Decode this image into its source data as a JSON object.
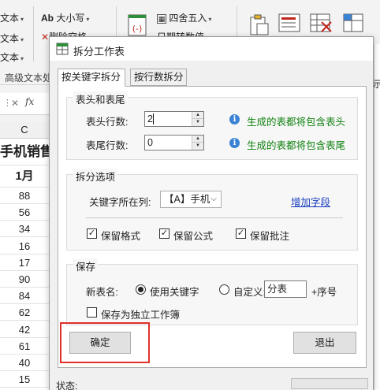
{
  "ribbon": {
    "left_items": [
      "文本",
      "文本",
      "文本"
    ],
    "case_label": "大小写",
    "case_icon_text": "Ab",
    "delete_label": "删除空格",
    "round_label": "四舍五入",
    "dateconv_label": "日期转数值",
    "advanced_text_label": "高级文本处"
  },
  "formula_bar": {
    "fx_label": "fx"
  },
  "sheet": {
    "column_header": "C",
    "title_cell": "手机销售",
    "month_cell": "1月",
    "values": [
      "88",
      "56",
      "34",
      "16",
      "17",
      "90",
      "84",
      "62",
      "42",
      "61",
      "40",
      "15",
      "79"
    ]
  },
  "dialog": {
    "title": "拆分工作表",
    "tabs": [
      {
        "label": "按关键字拆分",
        "active": true
      },
      {
        "label": "按行数拆分",
        "active": false
      }
    ],
    "header_footer": {
      "title": "表头和表尾",
      "header_rows_label": "表头行数:",
      "header_rows_value": "2",
      "header_hint": "生成的表都将包含表头",
      "footer_rows_label": "表尾行数:",
      "footer_rows_value": "0",
      "footer_hint": "生成的表都将包含表尾"
    },
    "split_options": {
      "title": "拆分选项",
      "key_column_label": "关键字所在列:",
      "key_column_value": "【A】手机",
      "add_field_link": "增加字段",
      "checkboxes": [
        {
          "label": "保留格式",
          "checked": true
        },
        {
          "label": "保留公式",
          "checked": true
        },
        {
          "label": "保留批注",
          "checked": true
        }
      ]
    },
    "save": {
      "title": "保存",
      "new_sheet_name_label": "新表名:",
      "radio_keyword_label": "使用关键字",
      "radio_keyword_checked": true,
      "radio_custom_label": "自定义:",
      "radio_custom_checked": false,
      "custom_value": "分表",
      "suffix_label": "+序号",
      "separate_workbook_label": "保存为独立工作簿",
      "separate_workbook_checked": false
    },
    "buttons": {
      "ok": "确定",
      "exit": "退出"
    },
    "status_label": "状态:",
    "highlight_color": "#e0302a",
    "hint_color": "#128212",
    "link_color": "#1a3fc0"
  },
  "right_panel": {
    "partial_label": "示"
  }
}
